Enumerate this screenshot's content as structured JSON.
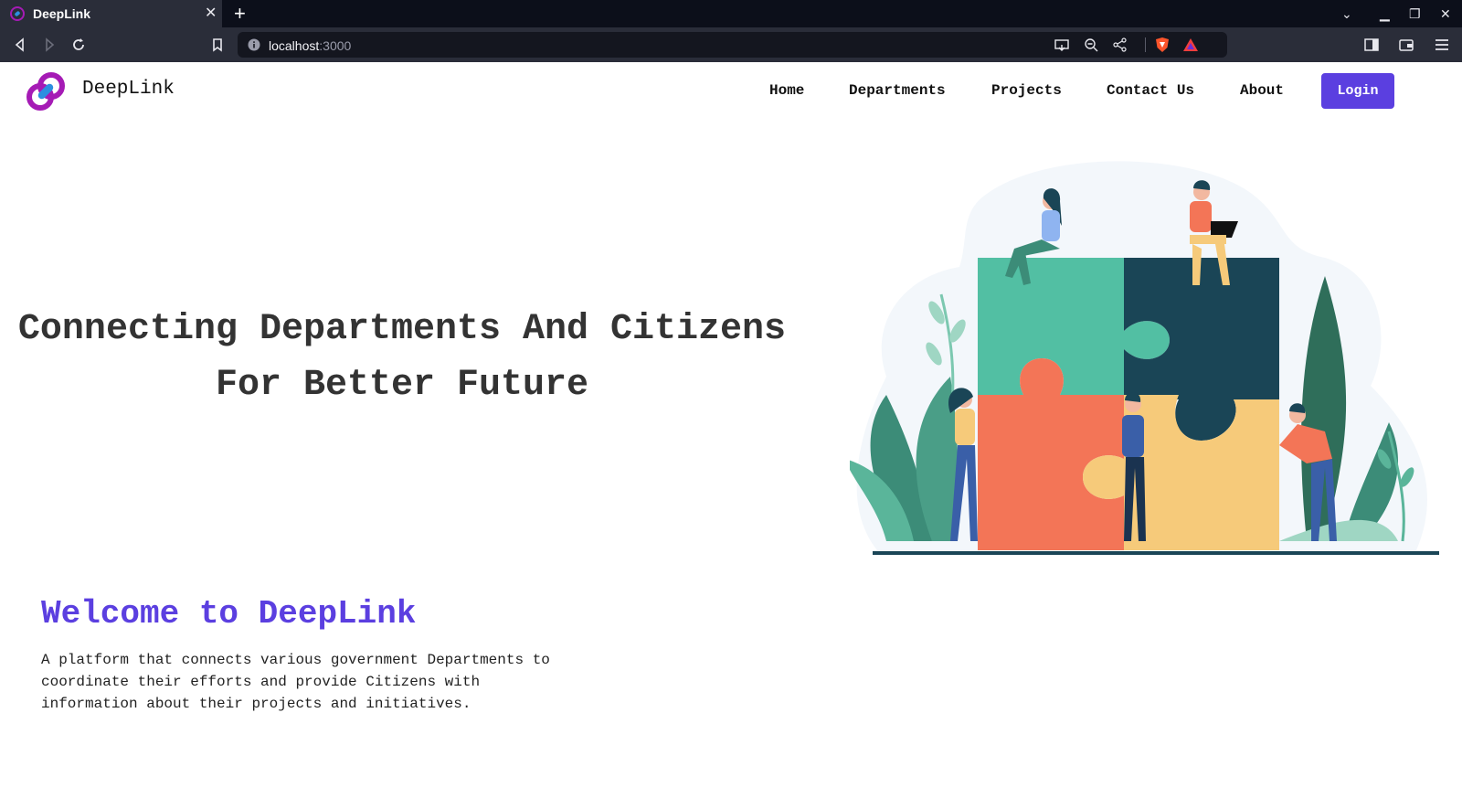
{
  "browser": {
    "tab_title": "DeepLink",
    "url_host": "localhost",
    "url_port": ":3000",
    "icons": {
      "tab_close": "close-icon",
      "new_tab": "plus-icon",
      "back": "back-icon",
      "forward": "forward-icon",
      "reload": "reload-icon",
      "bookmark": "bookmark-icon",
      "site_info": "info-icon",
      "cast": "cast-icon",
      "zoom": "zoom-out-icon",
      "share": "share-icon",
      "shields": "brave-shields-icon",
      "rewards": "brave-rewards-icon",
      "sidebar": "sidebar-icon",
      "wallet": "wallet-icon",
      "menu": "menu-icon"
    }
  },
  "header": {
    "brand": "DeepLink",
    "nav": [
      "Home",
      "Departments",
      "Projects",
      "Contact Us",
      "About"
    ],
    "login": "Login"
  },
  "hero": {
    "title_line1": "Connecting Departments And Citizens",
    "title_line2": "For Better Future"
  },
  "welcome": {
    "heading": "Welcome to DeepLink",
    "text": "A platform that connects various government Departments to coordinate their efforts and provide Citizens with information about their projects and initiatives."
  },
  "colors": {
    "accent": "#5b3fe0",
    "puzzle_green": "#52bfa3",
    "puzzle_navy": "#1a4556",
    "puzzle_orange": "#f37557",
    "puzzle_yellow": "#f6ca7a"
  }
}
